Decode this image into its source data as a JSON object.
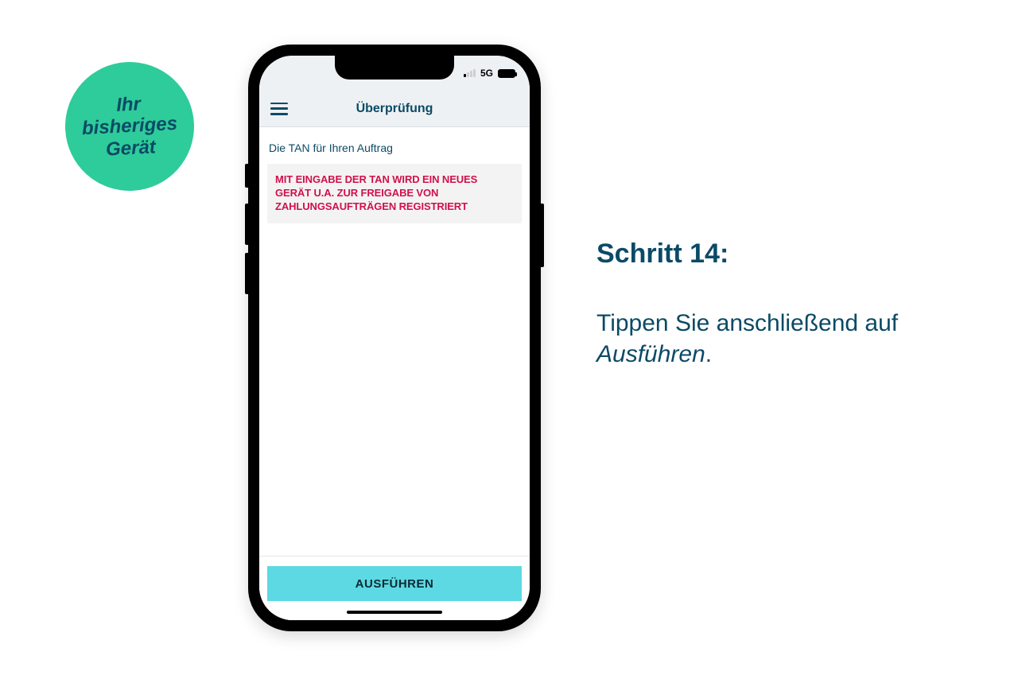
{
  "badge": {
    "line1": "Ihr",
    "line2": "bisheriges",
    "line3": "Gerät"
  },
  "status_bar": {
    "network_label": "5G"
  },
  "app": {
    "header_title": "Überprüfung",
    "tan_label": "Die TAN für Ihren Auftrag",
    "warning_text": "MIT EINGABE DER TAN WIRD EIN NEUES GERÄT U.A. ZUR FREIGABE VON ZAHLUNGSAUFTRÄGEN REGISTRIERT",
    "execute_button_label": "AUSFÜHREN"
  },
  "instructions": {
    "heading": "Schritt 14:",
    "body_prefix": "Tippen Sie anschließend auf ",
    "body_italic": "Ausführen",
    "body_suffix": "."
  },
  "colors": {
    "brand_dark": "#0b4a66",
    "badge_bg": "#2ecc9a",
    "warning_red": "#d0114b",
    "action_cyan": "#5dd9e3"
  }
}
